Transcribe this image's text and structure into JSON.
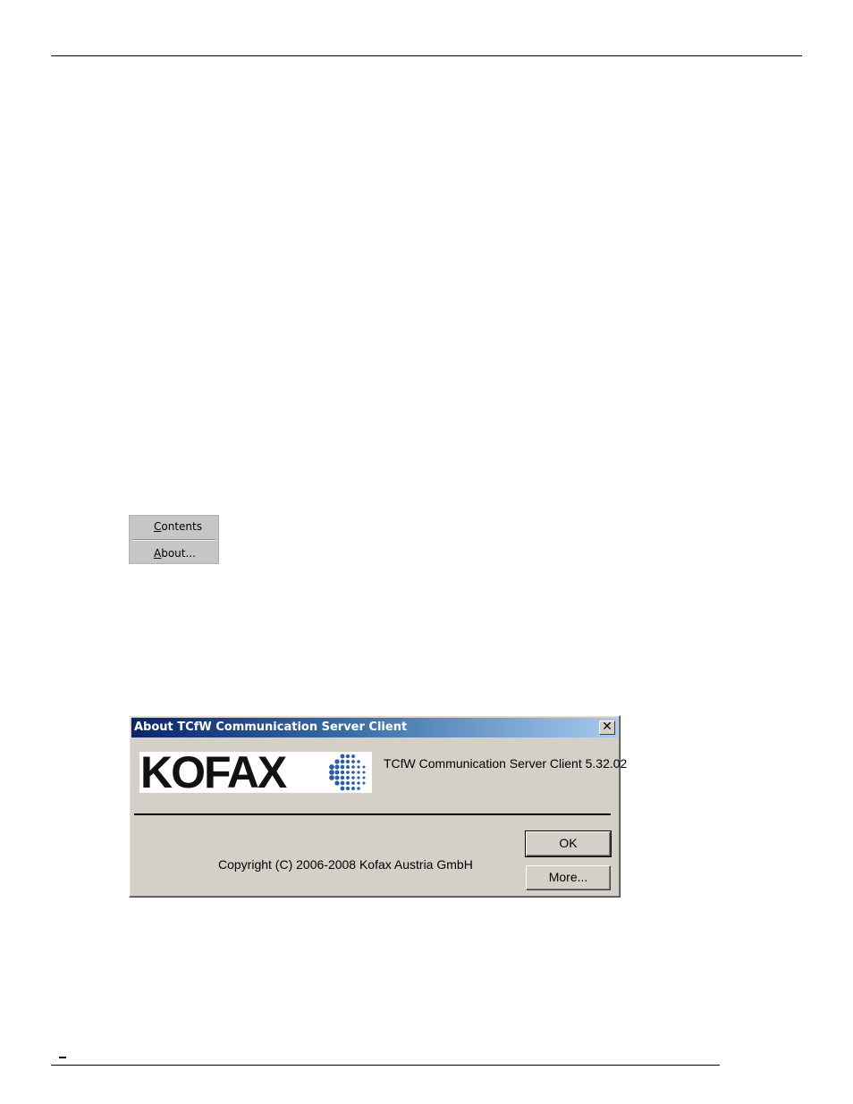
{
  "help_menu": {
    "items": [
      {
        "label_underline": "C",
        "label_rest": "ontents"
      },
      {
        "label_underline": "A",
        "label_rest": "bout..."
      }
    ]
  },
  "about_dialog": {
    "title": "About TCfW Communication Server Client",
    "close_glyph": "✕",
    "logo": {
      "text": "KOFAX",
      "icon": "kofax-globe-logo"
    },
    "product_name": "TCfW Communication Server Client 5.32.02",
    "copyright": "Copyright (C) 2006-2008 Kofax Austria GmbH",
    "ok_label": "OK",
    "more_label": "More..."
  },
  "colors": {
    "titlebar_start": "#0a246a",
    "titlebar_end": "#a6caf0",
    "dialog_bg": "#d4d0c8",
    "menu_bg": "#c6c6c6",
    "logo_dots": "#2a5db0"
  }
}
